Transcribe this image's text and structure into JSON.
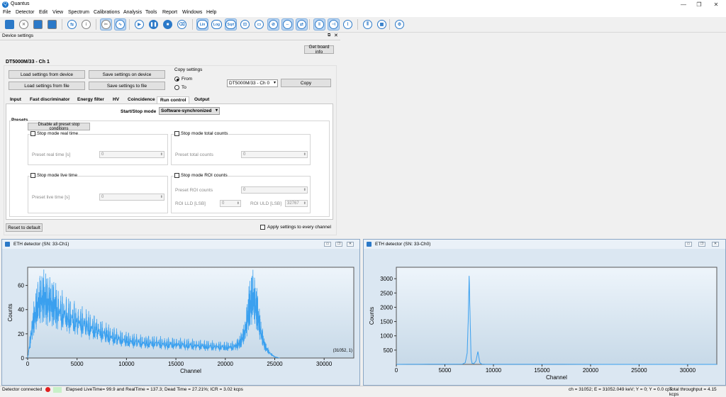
{
  "window": {
    "title": "Quantus"
  },
  "menu": [
    "File",
    "Detector",
    "Edit",
    "View",
    "Spectrum",
    "Calibrations",
    "Analysis",
    "Tools",
    "Report",
    "Windows",
    "Help"
  ],
  "toolbar": {
    "buttons": [
      {
        "name": "open-folder-icon"
      },
      {
        "name": "close-icon"
      },
      {
        "name": "save-icon"
      },
      {
        "name": "print-icon"
      },
      {
        "name": "connect-icon"
      },
      {
        "name": "info-icon"
      },
      {
        "name": "tools-icon"
      },
      {
        "name": "waveform-icon"
      },
      {
        "name": "play-icon"
      },
      {
        "name": "pause-icon"
      },
      {
        "name": "stop-icon"
      },
      {
        "name": "clear-icon"
      },
      {
        "name": "lin-scale-button",
        "text": "Lin"
      },
      {
        "name": "log-scale-button",
        "text": "Log"
      },
      {
        "name": "sqrt-scale-button",
        "text": "Sqrt"
      },
      {
        "name": "fit-icon"
      },
      {
        "name": "range-icon"
      },
      {
        "name": "ruler-icon"
      },
      {
        "name": "zoom-icon"
      },
      {
        "name": "sync-icon"
      },
      {
        "name": "vertical-marker-icon"
      },
      {
        "name": "horizontal-marker-icon"
      },
      {
        "name": "peak-icon"
      },
      {
        "name": "equalizer-icon"
      },
      {
        "name": "grid-icon"
      },
      {
        "name": "settings-icon"
      }
    ]
  },
  "device_settings": {
    "panel_title": "Device settings",
    "get_board_info": "Get board info",
    "device_label": "DT5000M/33 - Ch 1",
    "load_from_device": "Load settings from device",
    "save_on_device": "Save settings on device",
    "load_from_file": "Load settings from file",
    "save_to_file": "Save settings to file",
    "copy_settings": {
      "title": "Copy settings",
      "from": "From",
      "to": "To",
      "channel": "DT5000M/33 - Ch 0",
      "copy": "Copy"
    },
    "tabs": [
      "Input",
      "Fast discriminator",
      "Energy filter",
      "HV",
      "Coincidence",
      "Run control",
      "Output"
    ],
    "active_tab": "Run control",
    "start_stop_label": "Start/Stop mode",
    "start_stop_value": "Software-synchronized",
    "presets": {
      "title": "Presets",
      "disable_all": "Disable all preset stop conditions",
      "real_time": {
        "check": "Stop mode real time",
        "label": "Preset real time [s]",
        "value": "0"
      },
      "total_counts": {
        "check": "Stop mode total counts",
        "label": "Preset total counts",
        "value": "0"
      },
      "live_time": {
        "check": "Stop mode live time",
        "label": "Preset live time [s]",
        "value": "0"
      },
      "roi_counts": {
        "check": "Stop mode ROI counts",
        "label": "Preset ROI counts",
        "value": "0",
        "lld_label": "ROI LLD [LSB]",
        "lld_value": "0",
        "uld_label": "ROI ULD [LSB]",
        "uld_value": "32767"
      }
    },
    "reset_default": "Reset to default",
    "apply_every": "Apply settings to every channel"
  },
  "plots": [
    {
      "title": "ETH detector (SN: 33-Ch1)",
      "xlabel": "Channel",
      "ylabel": "Counts",
      "x_ticks": [
        "0",
        "5000",
        "10000",
        "15000",
        "20000",
        "25000",
        "30000"
      ],
      "y_ticks": [
        "0",
        "20",
        "40",
        "60"
      ],
      "cursor_readout": "(31052, 1)"
    },
    {
      "title": "ETH detector (SN: 33-Ch0)",
      "xlabel": "Channel",
      "ylabel": "Counts",
      "x_ticks": [
        "0",
        "5000",
        "10000",
        "15000",
        "20000",
        "25000",
        "30000"
      ],
      "y_ticks": [
        "500",
        "1000",
        "1500",
        "2000",
        "2500",
        "3000"
      ]
    }
  ],
  "chart_data": [
    {
      "type": "line",
      "title": "ETH detector (SN: 33-Ch1)",
      "xlabel": "Channel",
      "ylabel": "Counts",
      "xlim": [
        0,
        33000
      ],
      "ylim": [
        0,
        75
      ],
      "series": [
        {
          "color": "#3aa0ef",
          "x": [
            0,
            500,
            1000,
            1500,
            2000,
            2500,
            3000,
            4000,
            5000,
            6000,
            7000,
            8000,
            9000,
            10000,
            11000,
            12000,
            13000,
            14000,
            15000,
            16000,
            17000,
            18000,
            19000,
            20000,
            21000,
            21500,
            22000,
            22400,
            22800,
            23200,
            23600,
            24000,
            24500,
            25000,
            25500
          ],
          "y": [
            0,
            28,
            45,
            52,
            48,
            46,
            42,
            36,
            32,
            28,
            24,
            20,
            17,
            15,
            14,
            13,
            13,
            12,
            12,
            11.5,
            11,
            10.5,
            10,
            9.5,
            10,
            13,
            22,
            42,
            52,
            40,
            22,
            10,
            4,
            1,
            0
          ]
        }
      ]
    },
    {
      "type": "line",
      "title": "ETH detector (SN: 33-Ch0)",
      "xlabel": "Channel",
      "ylabel": "Counts",
      "xlim": [
        0,
        33000
      ],
      "ylim": [
        0,
        3400
      ],
      "series": [
        {
          "color": "#3aa0ef",
          "x": [
            0,
            6800,
            7100,
            7300,
            7400,
            7500,
            7600,
            7700,
            7800,
            8000,
            8200,
            8400,
            8500,
            8600,
            8800,
            9200,
            33000
          ],
          "y": [
            0,
            10,
            60,
            400,
            1500,
            3100,
            1600,
            200,
            40,
            30,
            120,
            450,
            250,
            60,
            10,
            2,
            0
          ]
        }
      ]
    }
  ],
  "status": {
    "connected": "Detector connected",
    "elapsed": "Elapsed LiveTime= 99.9 and RealTime = 137.3; Dead Time = 27.21%; ICR = 3.02 kcps",
    "cursor": "ch = 31052; E = 31052.049 keV; Y = 0; Y = 0.0 cps",
    "throughput": "Total throughput = 4.15 kcps"
  }
}
